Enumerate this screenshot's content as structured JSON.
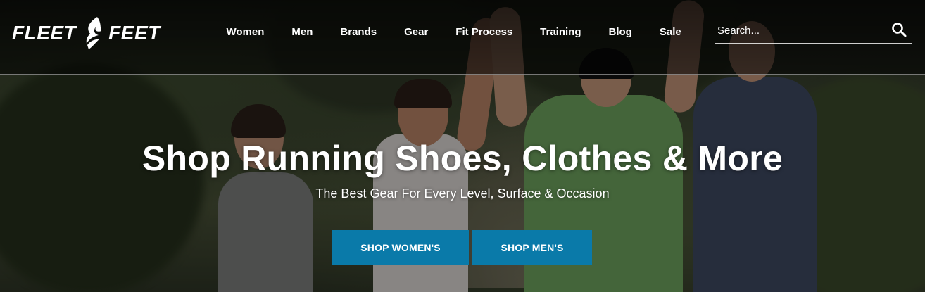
{
  "brand": {
    "logo_left": "FLEET",
    "logo_right": "FEET",
    "accent": "#0a7aa9"
  },
  "nav": {
    "items": [
      {
        "label": "Women"
      },
      {
        "label": "Men"
      },
      {
        "label": "Brands"
      },
      {
        "label": "Gear"
      },
      {
        "label": "Fit Process"
      },
      {
        "label": "Training"
      },
      {
        "label": "Blog"
      },
      {
        "label": "Sale"
      }
    ]
  },
  "search": {
    "placeholder": "Search...",
    "icon": "search-icon"
  },
  "hero": {
    "title": "Shop Running Shoes, Clothes & More",
    "subtitle": "The Best Gear For Every Level, Surface & Occasion",
    "buttons": [
      {
        "label": "SHOP WOMEN'S"
      },
      {
        "label": "SHOP MEN'S"
      }
    ]
  }
}
